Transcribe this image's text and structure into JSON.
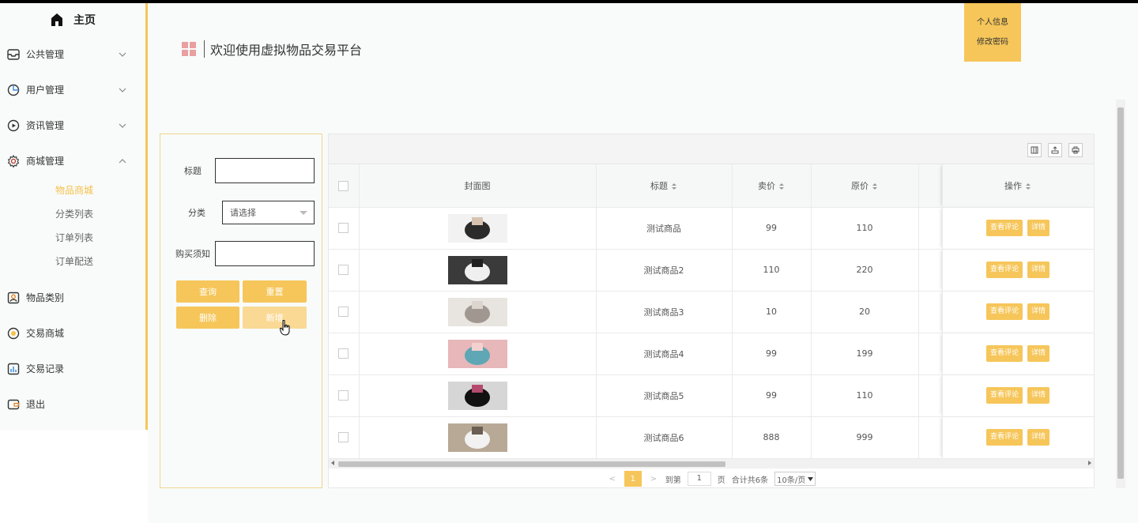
{
  "sidebar": {
    "home_label": "主页",
    "menu": [
      {
        "label": "公共管理"
      },
      {
        "label": "用户管理"
      },
      {
        "label": "资讯管理"
      },
      {
        "label": "商城管理"
      }
    ],
    "submenu": [
      {
        "label": "物品商城"
      },
      {
        "label": "分类列表"
      },
      {
        "label": "订单列表"
      },
      {
        "label": "订单配送"
      }
    ],
    "menu2": [
      {
        "label": "物品类别"
      },
      {
        "label": "交易商城"
      },
      {
        "label": "交易记录"
      },
      {
        "label": "退出"
      }
    ]
  },
  "header": {
    "title": "欢迎使用虚拟物品交易平台",
    "user_menu": [
      "个人信息",
      "修改密码"
    ]
  },
  "search": {
    "title_label": "标题",
    "category_label": "分类",
    "category_placeholder": "请选择",
    "notice_label": "购买须知",
    "query_button": "查询",
    "reset_button": "重置",
    "delete_button": "删除",
    "add_button": "新增"
  },
  "table": {
    "columns": [
      "封面图",
      "标题",
      "卖价",
      "原价",
      "操作"
    ],
    "rows": [
      {
        "title": "测试商品",
        "price": "99",
        "original": "110",
        "thumb": [
          "#f2f2f2",
          "#2b2b2b",
          "#d8c2b0"
        ]
      },
      {
        "title": "测试商品2",
        "price": "110",
        "original": "220",
        "thumb": [
          "#3a3a3a",
          "#efefef",
          "#1f1f1f"
        ]
      },
      {
        "title": "测试商品3",
        "price": "10",
        "original": "20",
        "thumb": [
          "#e8e4e0",
          "#a09890",
          "#dcd5ce"
        ]
      },
      {
        "title": "测试商品4",
        "price": "99",
        "original": "199",
        "thumb": [
          "#e7b7b9",
          "#5fa7b5",
          "#f2d1d0"
        ]
      },
      {
        "title": "测试商品5",
        "price": "99",
        "original": "110",
        "thumb": [
          "#d6d6d6",
          "#111111",
          "#b44a6d"
        ]
      },
      {
        "title": "测试商品6",
        "price": "888",
        "original": "999",
        "thumb": [
          "#b8a996",
          "#f2f2f2",
          "#6a5f52"
        ]
      }
    ],
    "op_view_comments": "查看评论",
    "op_detail": "详情"
  },
  "pager": {
    "prev": "<",
    "current_page": "1",
    "next": ">",
    "goto_label": "到第",
    "goto_value": "1",
    "page_unit": "页",
    "total_text": "合计共6条",
    "page_size": "10条/页"
  },
  "colors": {
    "accent": "#f6c65a",
    "accent_text": "#f6c04a"
  }
}
